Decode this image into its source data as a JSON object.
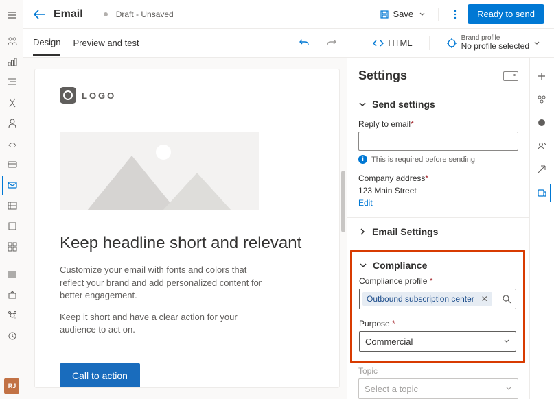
{
  "header": {
    "title": "Email",
    "draft_status": "Draft - Unsaved",
    "save_label": "Save",
    "ready_label": "Ready to send"
  },
  "tabs": {
    "design": "Design",
    "preview": "Preview and test"
  },
  "subbar": {
    "html_label": "HTML",
    "brand_profile_label": "Brand profile",
    "brand_profile_value": "No profile selected"
  },
  "canvas": {
    "logo_text": "LOGO",
    "headline": "Keep headline short and relevant",
    "body1": "Customize your email with fonts and colors that reflect your brand and add personalized content for better engagement.",
    "body2": "Keep it short and have a clear action for your audience to act on.",
    "cta": "Call to action"
  },
  "panel": {
    "title": "Settings",
    "send_settings": {
      "heading": "Send settings",
      "reply_label": "Reply to email",
      "reply_value": "",
      "reply_hint": "This is required before sending",
      "company_label": "Company address",
      "company_value": "123 Main Street",
      "edit": "Edit"
    },
    "email_settings_heading": "Email Settings",
    "compliance": {
      "heading": "Compliance",
      "profile_label": "Compliance profile ",
      "profile_value": "Outbound subscription center",
      "purpose_label": "Purpose ",
      "purpose_value": "Commercial"
    },
    "topic": {
      "label": "Topic",
      "placeholder": "Select a topic"
    }
  },
  "leftrail_user": "RJ"
}
